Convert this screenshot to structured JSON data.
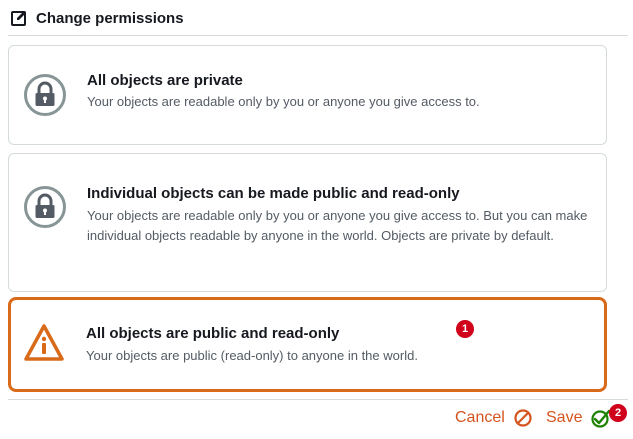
{
  "header": {
    "title": "Change permissions",
    "icon": "edit-icon"
  },
  "options": [
    {
      "title": "All objects are private",
      "description": "Your objects are readable only by you or anyone you give access to.",
      "icon": "lock-icon",
      "selected": false
    },
    {
      "title": "Individual objects can be made public and read-only",
      "description": "Your objects are readable only by you or anyone you give access to. But you can make individual objects readable by anyone in the world. Objects are private by default.",
      "icon": "lock-icon",
      "selected": false
    },
    {
      "title": "All objects are public and read-only",
      "description": "Your objects are public (read-only) to anyone in the world.",
      "icon": "warning-icon",
      "selected": true
    }
  ],
  "badges": {
    "first": "1",
    "second": "2"
  },
  "footer": {
    "cancel_label": "Cancel",
    "save_label": "Save"
  },
  "colors": {
    "accent": "#d5541e",
    "selected_border": "#d96a1a",
    "badge": "#d0021b",
    "save_check": "#1d8102"
  }
}
